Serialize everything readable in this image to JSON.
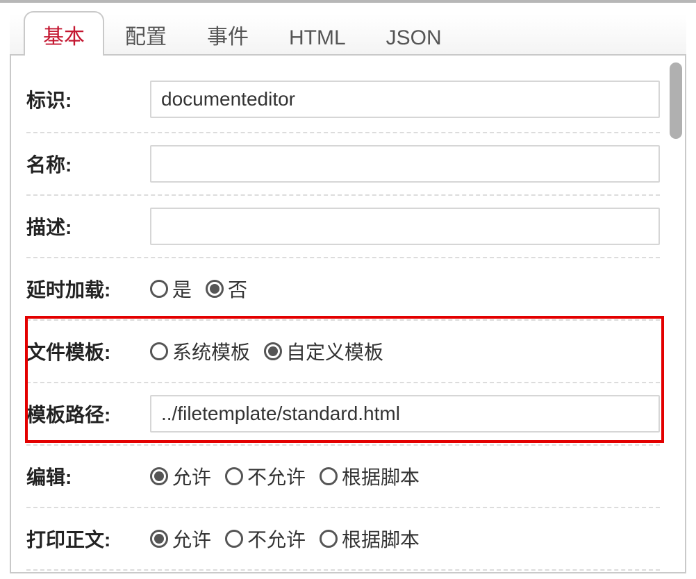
{
  "tabs": {
    "basic": "基本",
    "config": "配置",
    "event": "事件",
    "html": "HTML",
    "json": "JSON",
    "active": "basic"
  },
  "labels": {
    "id": "标识:",
    "name": "名称:",
    "desc": "描述:",
    "delay": "延时加载:",
    "fileTemplate": "文件模板:",
    "templatePath": "模板路径:",
    "edit": "编辑:",
    "printBody": "打印正文:"
  },
  "values": {
    "id": "documenteditor",
    "name": "",
    "desc": "",
    "templatePath": "../filetemplate/standard.html"
  },
  "radios": {
    "delay": {
      "yes": "是",
      "no": "否",
      "selected": "no"
    },
    "fileTemplate": {
      "system": "系统模板",
      "custom": "自定义模板",
      "selected": "custom"
    },
    "edit": {
      "allow": "允许",
      "deny": "不允许",
      "byScript": "根据脚本",
      "selected": "allow"
    },
    "printBody": {
      "allow": "允许",
      "deny": "不允许",
      "byScript": "根据脚本",
      "selected": "allow"
    }
  }
}
